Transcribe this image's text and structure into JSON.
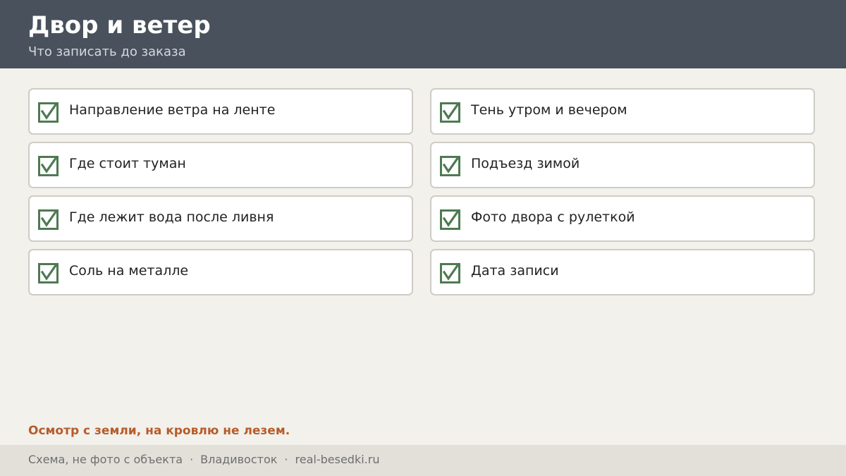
{
  "header": {
    "title": "Двор и ветер",
    "subtitle": "Что записать до заказа"
  },
  "checklist": {
    "icon": "checkbox-checked-icon",
    "check_color": "#4e7a52",
    "items": [
      {
        "label": "Направление ветра на ленте",
        "checked": true
      },
      {
        "label": "Тень утром и вечером",
        "checked": true
      },
      {
        "label": "Где стоит туман",
        "checked": true
      },
      {
        "label": "Подъезд зимой",
        "checked": true
      },
      {
        "label": "Где лежит вода после ливня",
        "checked": true
      },
      {
        "label": "Фото двора с рулеткой",
        "checked": true
      },
      {
        "label": "Соль на металле",
        "checked": true
      },
      {
        "label": "Дата записи",
        "checked": true
      }
    ]
  },
  "warning": "Осмотр с земли, на кровлю не лезем.",
  "footer": {
    "note": "Схема, не фото с объекта",
    "separator": "·",
    "city": "Владивосток",
    "site": "real-besedki.ru"
  },
  "colors": {
    "header_bg": "#48515c",
    "page_bg": "#f3f1ec",
    "accent_warning": "#b65c2b",
    "footer_bg": "#e3e0da"
  }
}
